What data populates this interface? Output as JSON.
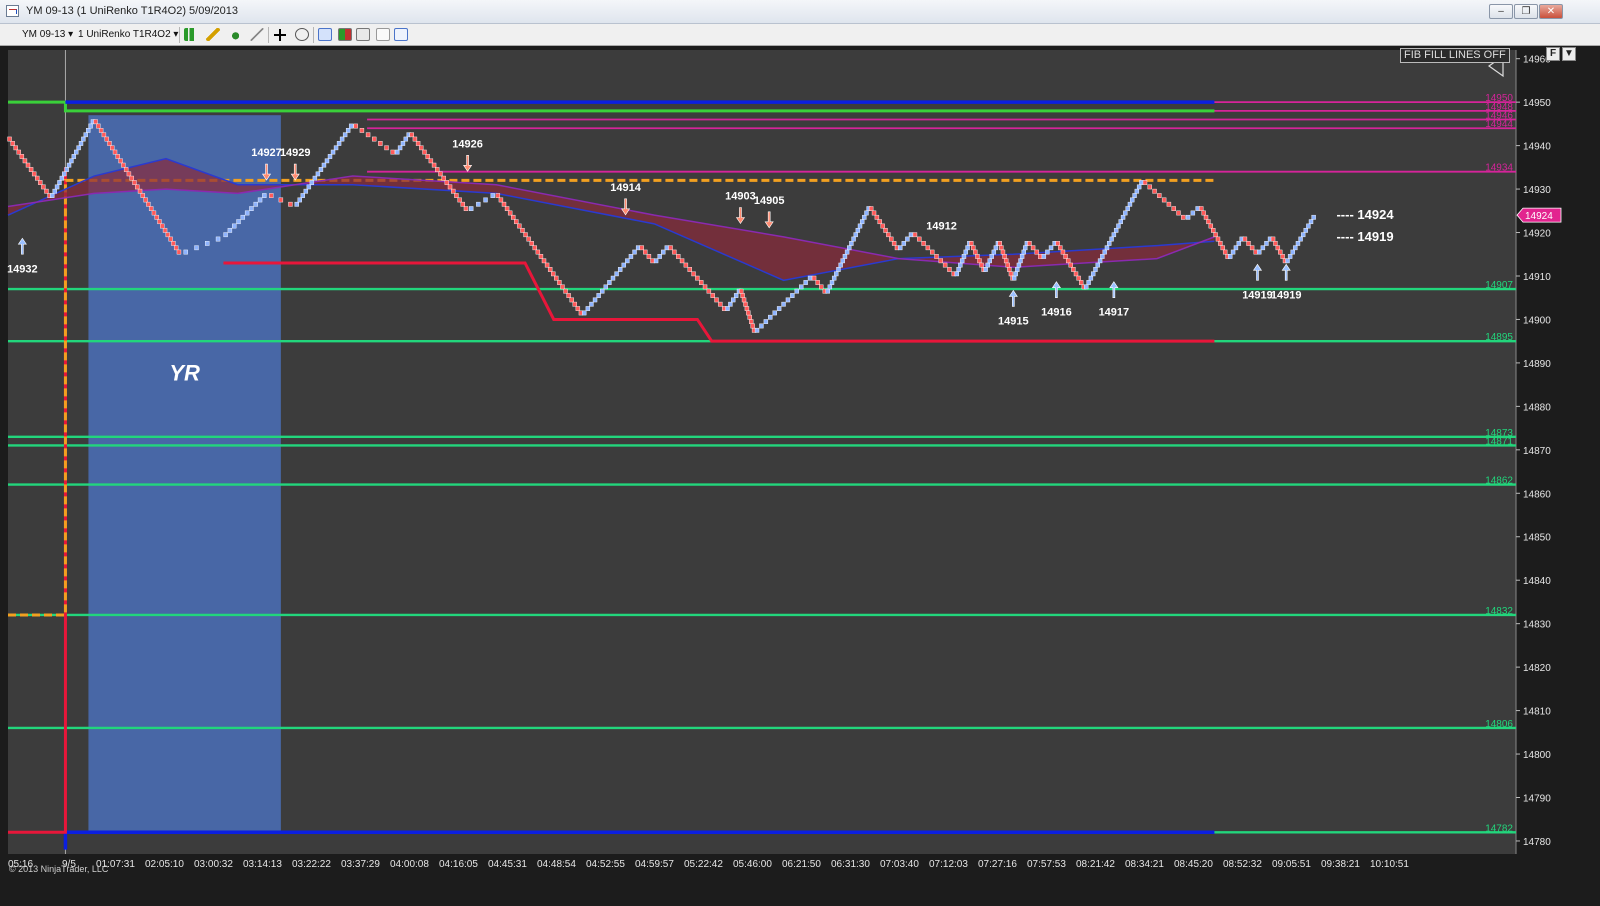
{
  "window": {
    "title": "YM 09-13 (1 UniRenko T1R4O2)  5/09/2013",
    "minimize_glyph": "‒",
    "restore_glyph": "❐",
    "close_glyph": "✕"
  },
  "toolbar": {
    "instrument": "YM 09-13",
    "period": "1 UniRenko T1R4O2"
  },
  "chart": {
    "fib_toggle_label": "FIB FILL LINES OFF",
    "f_button_label": "F",
    "collapse_glyph": "▼",
    "copyright": "© 2013 NinjaTrader, LLC",
    "session_label": "YR",
    "current_price": "14924",
    "colors": {
      "background": "#3c3c3c",
      "up_bar": "#8fb4ff",
      "down_bar": "#ff5a5a",
      "support_line": "#22d67c",
      "resistance_line": "#d6249a",
      "range_line": "#0b1fe0",
      "stop_line": "#e8163a",
      "pivot_line": "#f2a020",
      "highlight_box": "#4a6fb8"
    }
  },
  "chart_data": {
    "type": "renko",
    "instrument": "YM 09-13",
    "bar_type": "1 UniRenko T1R4O2",
    "y_axis": {
      "ticks": [
        14960,
        14950,
        14940,
        14930,
        14920,
        14910,
        14900,
        14890,
        14880,
        14870,
        14860,
        14850,
        14840,
        14830,
        14820,
        14810,
        14800,
        14790,
        14780
      ],
      "range": [
        14777,
        14962
      ]
    },
    "x_axis": {
      "ticks": [
        "05:16",
        "9/5",
        "01:07:31",
        "02:05:10",
        "03:00:32",
        "03:14:13",
        "03:22:22",
        "03:37:29",
        "04:00:08",
        "04:16:05",
        "04:45:31",
        "04:48:54",
        "04:52:55",
        "04:59:57",
        "05:22:42",
        "05:46:00",
        "06:21:50",
        "06:31:30",
        "07:03:40",
        "07:12:03",
        "07:27:16",
        "07:57:53",
        "08:21:42",
        "08:34:21",
        "08:45:20",
        "08:52:32",
        "09:05:51",
        "09:38:21",
        "10:10:51"
      ]
    },
    "price_path": [
      {
        "t": 0,
        "p": 14942
      },
      {
        "t": 3,
        "p": 14928
      },
      {
        "t": 6,
        "p": 14946
      },
      {
        "t": 12,
        "p": 14915
      },
      {
        "t": 15,
        "p": 14919
      },
      {
        "t": 18,
        "p": 14929
      },
      {
        "t": 20,
        "p": 14926
      },
      {
        "t": 24,
        "p": 14945
      },
      {
        "t": 27,
        "p": 14938
      },
      {
        "t": 28,
        "p": 14943
      },
      {
        "t": 32,
        "p": 14925
      },
      {
        "t": 34,
        "p": 14929
      },
      {
        "t": 40,
        "p": 14901
      },
      {
        "t": 44,
        "p": 14917
      },
      {
        "t": 45,
        "p": 14913
      },
      {
        "t": 46,
        "p": 14917
      },
      {
        "t": 50,
        "p": 14902
      },
      {
        "t": 51,
        "p": 14907
      },
      {
        "t": 52,
        "p": 14897
      },
      {
        "t": 56,
        "p": 14910
      },
      {
        "t": 57,
        "p": 14906
      },
      {
        "t": 60,
        "p": 14926
      },
      {
        "t": 62,
        "p": 14916
      },
      {
        "t": 63,
        "p": 14920
      },
      {
        "t": 66,
        "p": 14910
      },
      {
        "t": 67,
        "p": 14918
      },
      {
        "t": 68,
        "p": 14911
      },
      {
        "t": 69,
        "p": 14918
      },
      {
        "t": 70,
        "p": 14909
      },
      {
        "t": 71,
        "p": 14918
      },
      {
        "t": 72,
        "p": 14914
      },
      {
        "t": 73,
        "p": 14918
      },
      {
        "t": 75,
        "p": 14907
      },
      {
        "t": 79,
        "p": 14932
      },
      {
        "t": 82,
        "p": 14923
      },
      {
        "t": 83,
        "p": 14926
      },
      {
        "t": 85,
        "p": 14914
      },
      {
        "t": 86,
        "p": 14919
      },
      {
        "t": 87,
        "p": 14915
      },
      {
        "t": 88,
        "p": 14919
      },
      {
        "t": 89,
        "p": 14913
      },
      {
        "t": 91,
        "p": 14924
      }
    ],
    "horizontal_levels": [
      {
        "label": "14950",
        "value": 14950,
        "color": "resistance"
      },
      {
        "label": "14948",
        "value": 14948,
        "color": "resistance"
      },
      {
        "label": "14946",
        "value": 14946,
        "color": "resistance"
      },
      {
        "label": "14944",
        "value": 14944,
        "color": "resistance"
      },
      {
        "label": "14934",
        "value": 14934,
        "color": "resistance"
      },
      {
        "label": "14907",
        "value": 14907,
        "color": "support"
      },
      {
        "label": "14895",
        "value": 14895,
        "color": "support"
      },
      {
        "label": "14873",
        "value": 14873,
        "color": "support"
      },
      {
        "label": "14871",
        "value": 14871,
        "color": "support"
      },
      {
        "label": "14862",
        "value": 14862,
        "color": "support"
      },
      {
        "label": "14832",
        "value": 14832,
        "color": "support"
      },
      {
        "label": "14806",
        "value": 14806,
        "color": "support"
      },
      {
        "label": "14782",
        "value": 14782,
        "color": "support"
      }
    ],
    "annotations": [
      {
        "label": "14932",
        "t": 1,
        "p": 14915,
        "kind": "long"
      },
      {
        "label": "14927",
        "t": 18,
        "p": 14933,
        "kind": "short"
      },
      {
        "label": "14929",
        "t": 20,
        "p": 14933,
        "kind": "short"
      },
      {
        "label": "14926",
        "t": 32,
        "p": 14935,
        "kind": "short"
      },
      {
        "label": "14914",
        "t": 43,
        "p": 14925,
        "kind": "short"
      },
      {
        "label": "14903",
        "t": 51,
        "p": 14923,
        "kind": "short"
      },
      {
        "label": "14905",
        "t": 53,
        "p": 14922,
        "kind": "short"
      },
      {
        "label": "14912",
        "t": 65,
        "p": 14920,
        "kind": "none"
      },
      {
        "label": "14915",
        "t": 70,
        "p": 14903,
        "kind": "long"
      },
      {
        "label": "14916",
        "t": 73,
        "p": 14905,
        "kind": "long"
      },
      {
        "label": "14917",
        "t": 77,
        "p": 14905,
        "kind": "long"
      },
      {
        "label": "14919",
        "t": 87,
        "p": 14909,
        "kind": "long"
      },
      {
        "label": "14919",
        "t": 89,
        "p": 14909,
        "kind": "long"
      }
    ],
    "right_markers": [
      {
        "label": "---- 14924",
        "value": 14924
      },
      {
        "label": "---- 14919",
        "value": 14919
      }
    ]
  }
}
